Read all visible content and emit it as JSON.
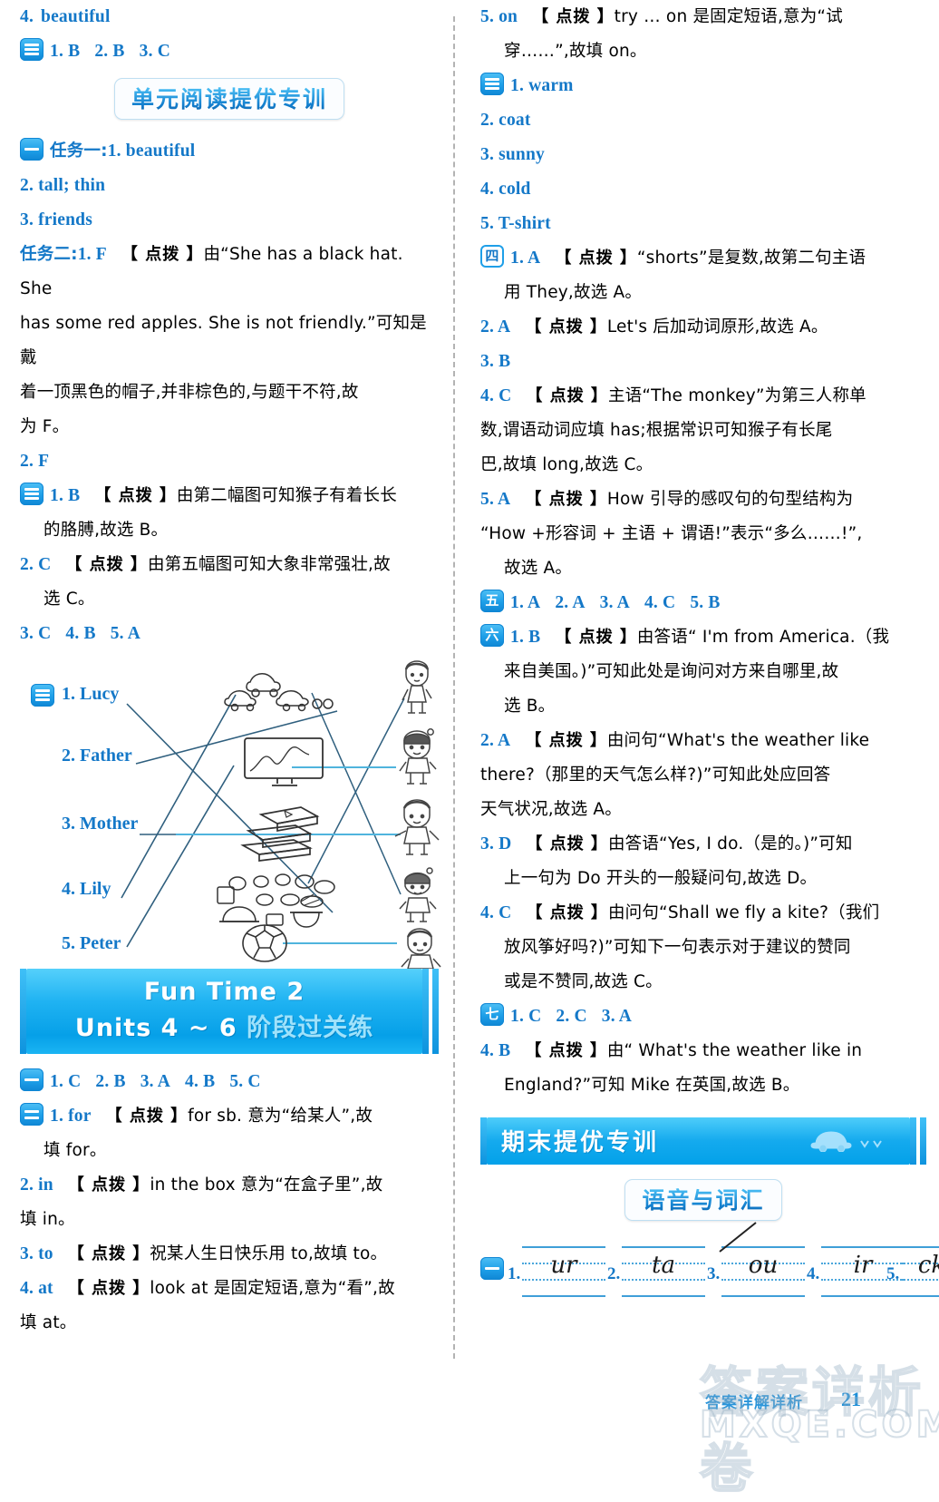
{
  "page": {
    "number": "21",
    "footer_note": "答案详解详析",
    "watermark1": "答案详析卷",
    "watermark2": "MXQE.COM"
  },
  "left": {
    "top_item4": {
      "num": "4.",
      "answer": "beautiful"
    },
    "row_three": {
      "badge": "三",
      "items": [
        "1. B",
        "2. B",
        "3. C"
      ]
    },
    "heading_pill": "单元阅读提优专训",
    "task1": {
      "badge": "一",
      "label": "任务一:",
      "first": "1. beautiful"
    },
    "task1_lines": [
      "2. tall; thin",
      "3. friends"
    ],
    "task2": {
      "label": "任务二:",
      "answer": "1. F",
      "tag": "【 点拨 】",
      "text_l1": "由“She has a black hat. She",
      "text_l2": "has some red apples. She is not friendly.”可知是戴",
      "text_l3": "着一顶黑色的帽子,并非棕色的,与题干不符,故",
      "text_l4": "为 F。",
      "item2": "2. F"
    },
    "three_b": {
      "badge": "三",
      "answer": "1. B",
      "tag": "【 点拨 】",
      "l1": "由第二幅图可知猴子有着长长",
      "l2": "的胳膊,故选 B。",
      "a2": "2. C",
      "tag2": "【 点拨 】",
      "l3": "由第五幅图可知大象非常强壮,故",
      "l4": "选 C。",
      "rest": [
        "3. C",
        "4. B",
        "5. A"
      ]
    },
    "match": {
      "badge": "三",
      "names": [
        "1. Lucy",
        "2. Father",
        "3. Mother",
        "4. Lily",
        "5. Peter"
      ],
      "pictures": [
        "toy-cars",
        "television",
        "books-stack",
        "food-dishes",
        "soccer-ball"
      ],
      "people": [
        "woman-standing",
        "girl-with-bow",
        "boy-pointing",
        "girl-with-ponytail",
        "boy-in-jacket"
      ]
    },
    "banner": {
      "line1": "Fun Time 2",
      "line2_en": "Units 4 ~ 6",
      "line2_cn": "阶段过关练"
    },
    "one_row": {
      "badge": "一",
      "items": [
        "1. C",
        "2. B",
        "3. A",
        "4. B",
        "5. C"
      ]
    },
    "two_sec": {
      "badge": "二",
      "a1": "1. for",
      "tag1": "【 点拨 】",
      "t1a": "for sb. 意为“给某人”,故",
      "t1b": "填 for。",
      "a2": "2. in",
      "tag2": "【 点拨 】",
      "t2a": "in the box 意为“在盒子里”,故",
      "t2b": "填 in。",
      "a3": "3. to",
      "tag3": "【 点拨 】",
      "t3a": "祝某人生日快乐用 to,故填 to。",
      "a4": "4. at",
      "tag4": "【 点拨 】",
      "t4a": "look at 是固定短语,意为“看”,故",
      "t4b": "填 at。"
    }
  },
  "right": {
    "item5_on": {
      "a": "5. on",
      "tag": "【 点拨 】",
      "l1": "try … on 是固定短语,意为“试",
      "l2": "穿……”,故填 on。"
    },
    "three_words": {
      "badge": "三",
      "items": [
        "1. warm",
        "2. coat",
        "3. sunny",
        "4. cold",
        "5. T-shirt"
      ]
    },
    "four_sec": {
      "badge": "四",
      "a1": "1. A",
      "tag1": "【 点拨 】",
      "t1a": "“shorts”是复数,故第二句主语",
      "t1b": "用 They,故选 A。",
      "a2": "2. A",
      "tag2": "【 点拨 】",
      "t2a": "Let's 后加动词原形,故选 A。",
      "a3": "3. B",
      "a4": "4. C",
      "tag4": "【 点拨 】",
      "t4a": "主语“The monkey”为第三人称单",
      "t4b": "数,谓语动词应填 has;根据常识可知猴子有长尾",
      "t4c": "巴,故填 long,故选 C。",
      "a5": "5. A",
      "tag5": "【 点拨 】",
      "t5a": "How 引导的感叹句的句型结构为",
      "t5b": "“How +形容词 + 主语 + 谓语!”表示“多么……!”,",
      "t5c": "故选 A。"
    },
    "five_row": {
      "badge": "五",
      "items": [
        "1. A",
        "2. A",
        "3. A",
        "4. C",
        "5. B"
      ]
    },
    "six_sec": {
      "badge": "六",
      "a1": "1. B",
      "tag1": "【 点拨 】",
      "t1a": "由答语“ I'm from America.（我",
      "t1b": "来自美国。)”可知此处是询问对方来自哪里,故",
      "t1c": "选 B。",
      "a2": "2. A",
      "tag2": "【 点拨 】",
      "t2a": "由问句“What's the weather like",
      "t2b": "there?（那里的天气怎么样?)”可知此处应回答",
      "t2c": "天气状况,故选 A。",
      "a3": "3. D",
      "tag3": "【 点拨 】",
      "t3a": "由答语“Yes, I do.（是的。)”可知",
      "t3b": "上一句为 Do 开头的一般疑问句,故选 D。",
      "a4": "4. C",
      "tag4": "【 点拨 】",
      "t4a": "由问句“Shall we fly a kite?（我们",
      "t4b": "放风筝好吗?)”可知下一句表示对于建议的赞同",
      "t4c": "或是不赞同,故选 C。"
    },
    "seven_row": {
      "badge": "七",
      "items": [
        "1. C",
        "2. C",
        "3. A"
      ]
    },
    "seven_b": {
      "a4": "4. B",
      "tag": "【 点拨 】",
      "l1": "由“ What's the weather like in",
      "l2": "England?”可知 Mike 在英国,故选 B。"
    },
    "banner_sm": {
      "title": "期末提优专训",
      "icon": "car-icon"
    },
    "pill": "语音与词汇",
    "phonics": {
      "badge": "一",
      "items": [
        {
          "num": "1.",
          "word": "ur"
        },
        {
          "num": "2.",
          "word": "ta"
        },
        {
          "num": "3.",
          "word": "ou"
        },
        {
          "num": "4.",
          "word": "ir"
        },
        {
          "num": "5.",
          "word": "ck"
        }
      ]
    }
  },
  "colors": {
    "accent": "#1478c8",
    "banner": "#06a0e8",
    "banner_light": "#55d0fb"
  }
}
